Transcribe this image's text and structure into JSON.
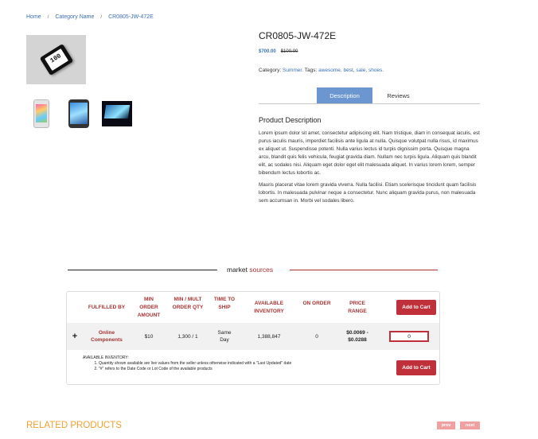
{
  "breadcrumb": {
    "home": "Home",
    "category": "Category Name",
    "current": "CR0805-JW-472E",
    "separator": "/"
  },
  "product": {
    "main_image_label": "100",
    "title": "CR0805-JW-472E",
    "price_new": "$700.00",
    "price_old": "$100.00",
    "category_label": "Category:",
    "category": "Summer.",
    "tags_label": "Tags:",
    "tags": [
      "awesome,",
      "best,",
      "sale,",
      "shoes."
    ]
  },
  "tabs": {
    "description": "Description",
    "reviews": "Reviews"
  },
  "description": {
    "title": "Product Description",
    "p1": "Lorem ipsum dolor sit amet, consectetur adipiscing elit. Nam tristique, diam in consequat iaculis, est purus iaculis mauris, imperdiet facilisis ante ligula at nulla. Quisque volutpat nulla risus, id maximus ex aliquet ut. Suspendisse potenti. Nulla varius lectus id turpis dignissim porta. Quisque magna arcu, blandit quis felis vehicula, feugiat gravida diam. Nullam nec turpis ligula. Aliquam quis blandit elit, ac sodales nisi. Aliquam eget dolor eget elit malesuada aliquet. In varius lorem lorem, semper bibendum lectus lobortis ac.",
    "p2": "Mauris placerat vitae lorem gravida viverra. Nulla facilisi. Etiam scelerisque tincidunt quam facilisis lobortis. In malesuada pulvinar neque a consectetur. Nunc aliquam gravida purus, non malesuada sem accumsan in. Morbi vel sodales libero."
  },
  "market_sources": {
    "title_a": "market ",
    "title_b": "sources",
    "headers": {
      "fulfilled_by": "FULFILLED BY",
      "min_order": "MIN ORDER AMOUNT",
      "min_mult": "MIN / MULT ORDER QTY",
      "time_to_ship": "TIME TO SHIP",
      "available": "AVAILABLE INVENTORY",
      "on_order": "ON ORDER",
      "price_range": "PRICE RANGE"
    },
    "add_to_cart": "Add to Cart",
    "row": {
      "expand": "+",
      "fulfilled_by": "Online Components",
      "min_order": "$10",
      "min_mult": "1,300 / 1",
      "time_to_ship": "Same Day",
      "available": "1,388,847",
      "on_order": "0",
      "price_range": "$0.0069 - $0.0288",
      "qty": "0"
    },
    "notes_title": "AVAILABLE INVENTORY:",
    "notes": [
      "Quantity shown available are live values from the seller unless otherwise indicated with a \"Last Updated\" date",
      "\"#\" refers to the Date Code or Lot Code of the available products"
    ]
  },
  "related": {
    "title": "RELATED PRODUCTS",
    "prev": "prev",
    "next": "next"
  }
}
